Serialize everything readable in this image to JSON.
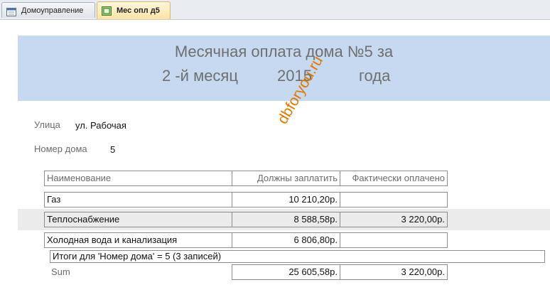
{
  "tabs": [
    {
      "label": "Домоуправление",
      "icon": "form-icon",
      "active": false
    },
    {
      "label": "Мес опл д5",
      "icon": "report-icon",
      "active": true
    }
  ],
  "report": {
    "title_line1": "Месячная оплата дома №5 за",
    "month": "2 -й месяц",
    "year": "2015",
    "year_word": "года",
    "street_label": "Улица",
    "street_value": "ул.  Рабочая",
    "house_label": "Номер дома",
    "house_value": "5",
    "watermark": "dbforyou.ru",
    "columns": [
      "Наименование",
      "Должны заплатить",
      "Фактически оплачено"
    ],
    "rows": [
      {
        "name": "Газ",
        "due": "10 210,20р.",
        "paid": ""
      },
      {
        "name": "Теплоснабжение",
        "due": "8 588,58р.",
        "paid": "3 220,00р."
      },
      {
        "name": "Холодная вода и канализация",
        "due": "6 806,80р.",
        "paid": ""
      }
    ],
    "group_footer": "Итоги для 'Номер дома' =  5 (3 записей)",
    "sum_label": "Sum",
    "sum_due": "25 605,58р.",
    "sum_paid": "3 220,00р."
  }
}
